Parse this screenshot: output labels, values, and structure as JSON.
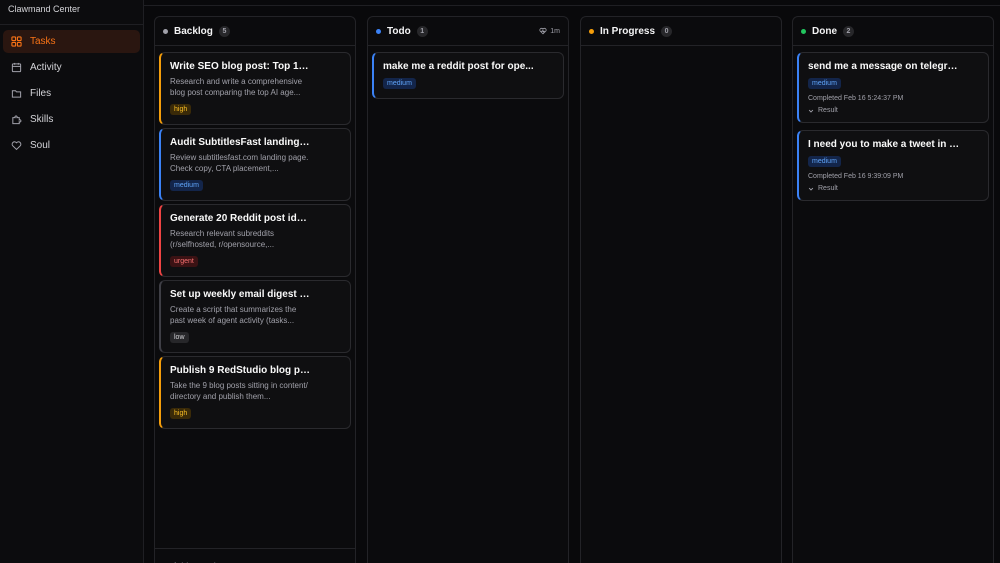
{
  "sidebar": {
    "brand": "Clawmand Center",
    "items": [
      {
        "label": "Tasks",
        "icon": "grid-icon"
      },
      {
        "label": "Activity",
        "icon": "calendar-icon"
      },
      {
        "label": "Files",
        "icon": "folder-icon"
      },
      {
        "label": "Skills",
        "icon": "puzzle-icon"
      },
      {
        "label": "Soul",
        "icon": "heart-icon"
      }
    ]
  },
  "colors": {
    "accent": "#f97316",
    "backlog_dot": "#a1a1aa",
    "todo_dot": "#3b82f6",
    "progress_dot": "#f59e0b",
    "done_dot": "#22c55e"
  },
  "columns": {
    "backlog": {
      "title": "Backlog",
      "count": "5",
      "add_card": "+  Add a card",
      "cards": [
        {
          "title": "Write SEO blog post: Top 10 AI...",
          "desc": "Research and write a comprehensive blog post comparing the top AI age...",
          "priority": "high"
        },
        {
          "title": "Audit SubtitlesFast landing pa...",
          "desc": "Review subtitlesfast.com landing page. Check copy, CTA placement,...",
          "priority": "medium"
        },
        {
          "title": "Generate 20 Reddit post ideas...",
          "desc": "Research relevant subreddits (r/selfhosted, r/opensource,...",
          "priority": "urgent"
        },
        {
          "title": "Set up weekly email digest of ...",
          "desc": "Create a script that summarizes the past week of agent activity (tasks...",
          "priority": "low"
        },
        {
          "title": "Publish 9 RedStudio blog post...",
          "desc": "Take the 9 blog posts sitting in content/ directory and publish them...",
          "priority": "high"
        }
      ]
    },
    "todo": {
      "title": "Todo",
      "count": "1",
      "extra": "1m",
      "cards": [
        {
          "title": "make me a reddit post for ope...",
          "priority": "medium"
        }
      ]
    },
    "in_progress": {
      "title": "In Progress",
      "count": "0"
    },
    "done": {
      "title": "Done",
      "count": "2",
      "cards": [
        {
          "title": "send me a message on telegram ...",
          "priority": "medium",
          "completed": "Completed Feb 16 5:24:37 PM",
          "result": "Result"
        },
        {
          "title": "I need you to make a tweet in my ...",
          "priority": "medium",
          "completed": "Completed Feb 16 9:39:09 PM",
          "result": "Result"
        }
      ]
    }
  }
}
